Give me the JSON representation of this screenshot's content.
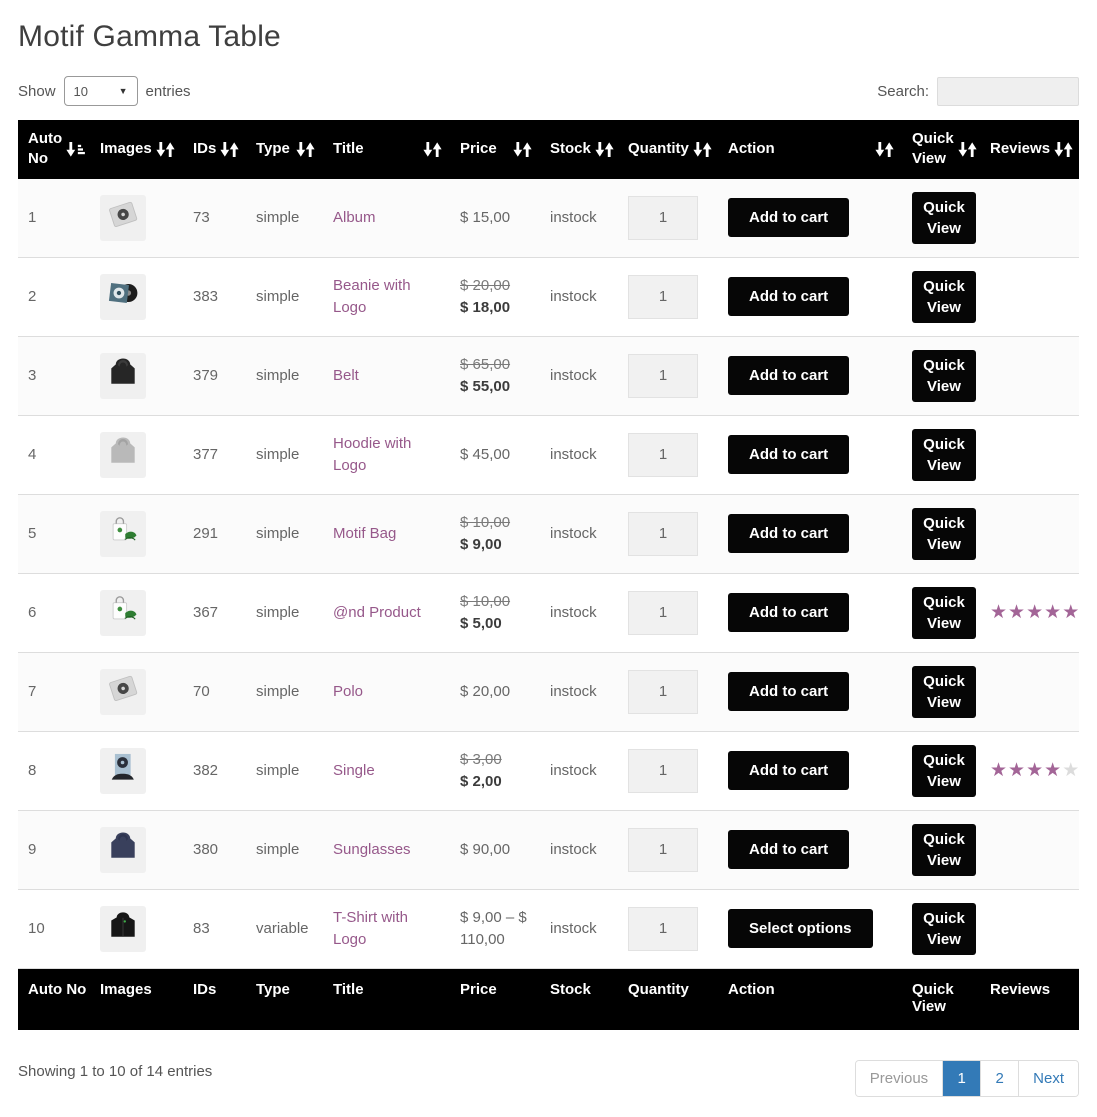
{
  "page": {
    "title": "Motif Gamma Table"
  },
  "controls": {
    "show_label": "Show",
    "page_length": "10",
    "entries_label": "entries",
    "search_label": "Search:",
    "search_value": ""
  },
  "table": {
    "quick_view_label": "Quick View",
    "headers": [
      {
        "label": "Auto No",
        "sort": "asc"
      },
      {
        "label": "Images",
        "sort": "both"
      },
      {
        "label": "IDs",
        "sort": "both"
      },
      {
        "label": "Type",
        "sort": "both"
      },
      {
        "label": "Title",
        "sort": "both"
      },
      {
        "label": "Price",
        "sort": "both"
      },
      {
        "label": "Stock",
        "sort": "both"
      },
      {
        "label": "Quantity",
        "sort": "both"
      },
      {
        "label": "Action",
        "sort": "both"
      },
      {
        "label": "Quick View",
        "sort": "both"
      },
      {
        "label": "Reviews",
        "sort": "both"
      }
    ],
    "rows": [
      {
        "no": "1",
        "image": "vinyl",
        "id": "73",
        "type": "simple",
        "title": "Album",
        "price_old": null,
        "price": "$ 15,00",
        "stock": "instock",
        "qty": "1",
        "action": "Add to cart",
        "rating": null
      },
      {
        "no": "2",
        "image": "vinyl-blue",
        "id": "383",
        "type": "simple",
        "title": "Beanie with Logo",
        "price_old": "$ 20,00",
        "price": "$ 18,00",
        "stock": "instock",
        "qty": "1",
        "action": "Add to cart",
        "rating": null
      },
      {
        "no": "3",
        "image": "hoodie-dark",
        "id": "379",
        "type": "simple",
        "title": "Belt",
        "price_old": "$ 65,00",
        "price": "$ 55,00",
        "stock": "instock",
        "qty": "1",
        "action": "Add to cart",
        "rating": null
      },
      {
        "no": "4",
        "image": "hoodie-grey",
        "id": "377",
        "type": "simple",
        "title": "Hoodie with Logo",
        "price_old": null,
        "price": "$ 45,00",
        "stock": "instock",
        "qty": "1",
        "action": "Add to cart",
        "rating": null
      },
      {
        "no": "5",
        "image": "bag-green",
        "id": "291",
        "type": "simple",
        "title": "Motif Bag",
        "price_old": "$ 10,00",
        "price": "$ 9,00",
        "stock": "instock",
        "qty": "1",
        "action": "Add to cart",
        "rating": null
      },
      {
        "no": "6",
        "image": "bag-green",
        "id": "367",
        "type": "simple",
        "title": "@nd Product",
        "price_old": "$ 10,00",
        "price": "$ 5,00",
        "stock": "instock",
        "qty": "1",
        "action": "Add to cart",
        "rating": 5
      },
      {
        "no": "7",
        "image": "vinyl",
        "id": "70",
        "type": "simple",
        "title": "Polo",
        "price_old": null,
        "price": "$ 20,00",
        "stock": "instock",
        "qty": "1",
        "action": "Add to cart",
        "rating": null
      },
      {
        "no": "8",
        "image": "single-blue",
        "id": "382",
        "type": "simple",
        "title": "Single",
        "price_old": "$ 3,00",
        "price": "$ 2,00",
        "stock": "instock",
        "qty": "1",
        "action": "Add to cart",
        "rating": 4
      },
      {
        "no": "9",
        "image": "hoodie-navy",
        "id": "380",
        "type": "simple",
        "title": "Sunglasses",
        "price_old": null,
        "price": "$ 90,00",
        "stock": "instock",
        "qty": "1",
        "action": "Add to cart",
        "rating": null
      },
      {
        "no": "10",
        "image": "jacket-black",
        "id": "83",
        "type": "variable",
        "title": "T-Shirt with Logo",
        "price_old": null,
        "price": "$ 9,00 – $ 110,00",
        "stock": "instock",
        "qty": "1",
        "action": "Select options",
        "rating": null
      }
    ]
  },
  "footer": {
    "info": "Showing 1 to 10 of 14 entries",
    "pagination": {
      "previous": "Previous",
      "pages": [
        "1",
        "2"
      ],
      "active": "1",
      "next": "Next"
    }
  },
  "colors": {
    "header_bg": "#000000",
    "link": "#96588a",
    "star": "#a36597",
    "star_empty": "#dcdcdc",
    "pagination_active": "#337ab7",
    "button_bg": "#060606"
  }
}
